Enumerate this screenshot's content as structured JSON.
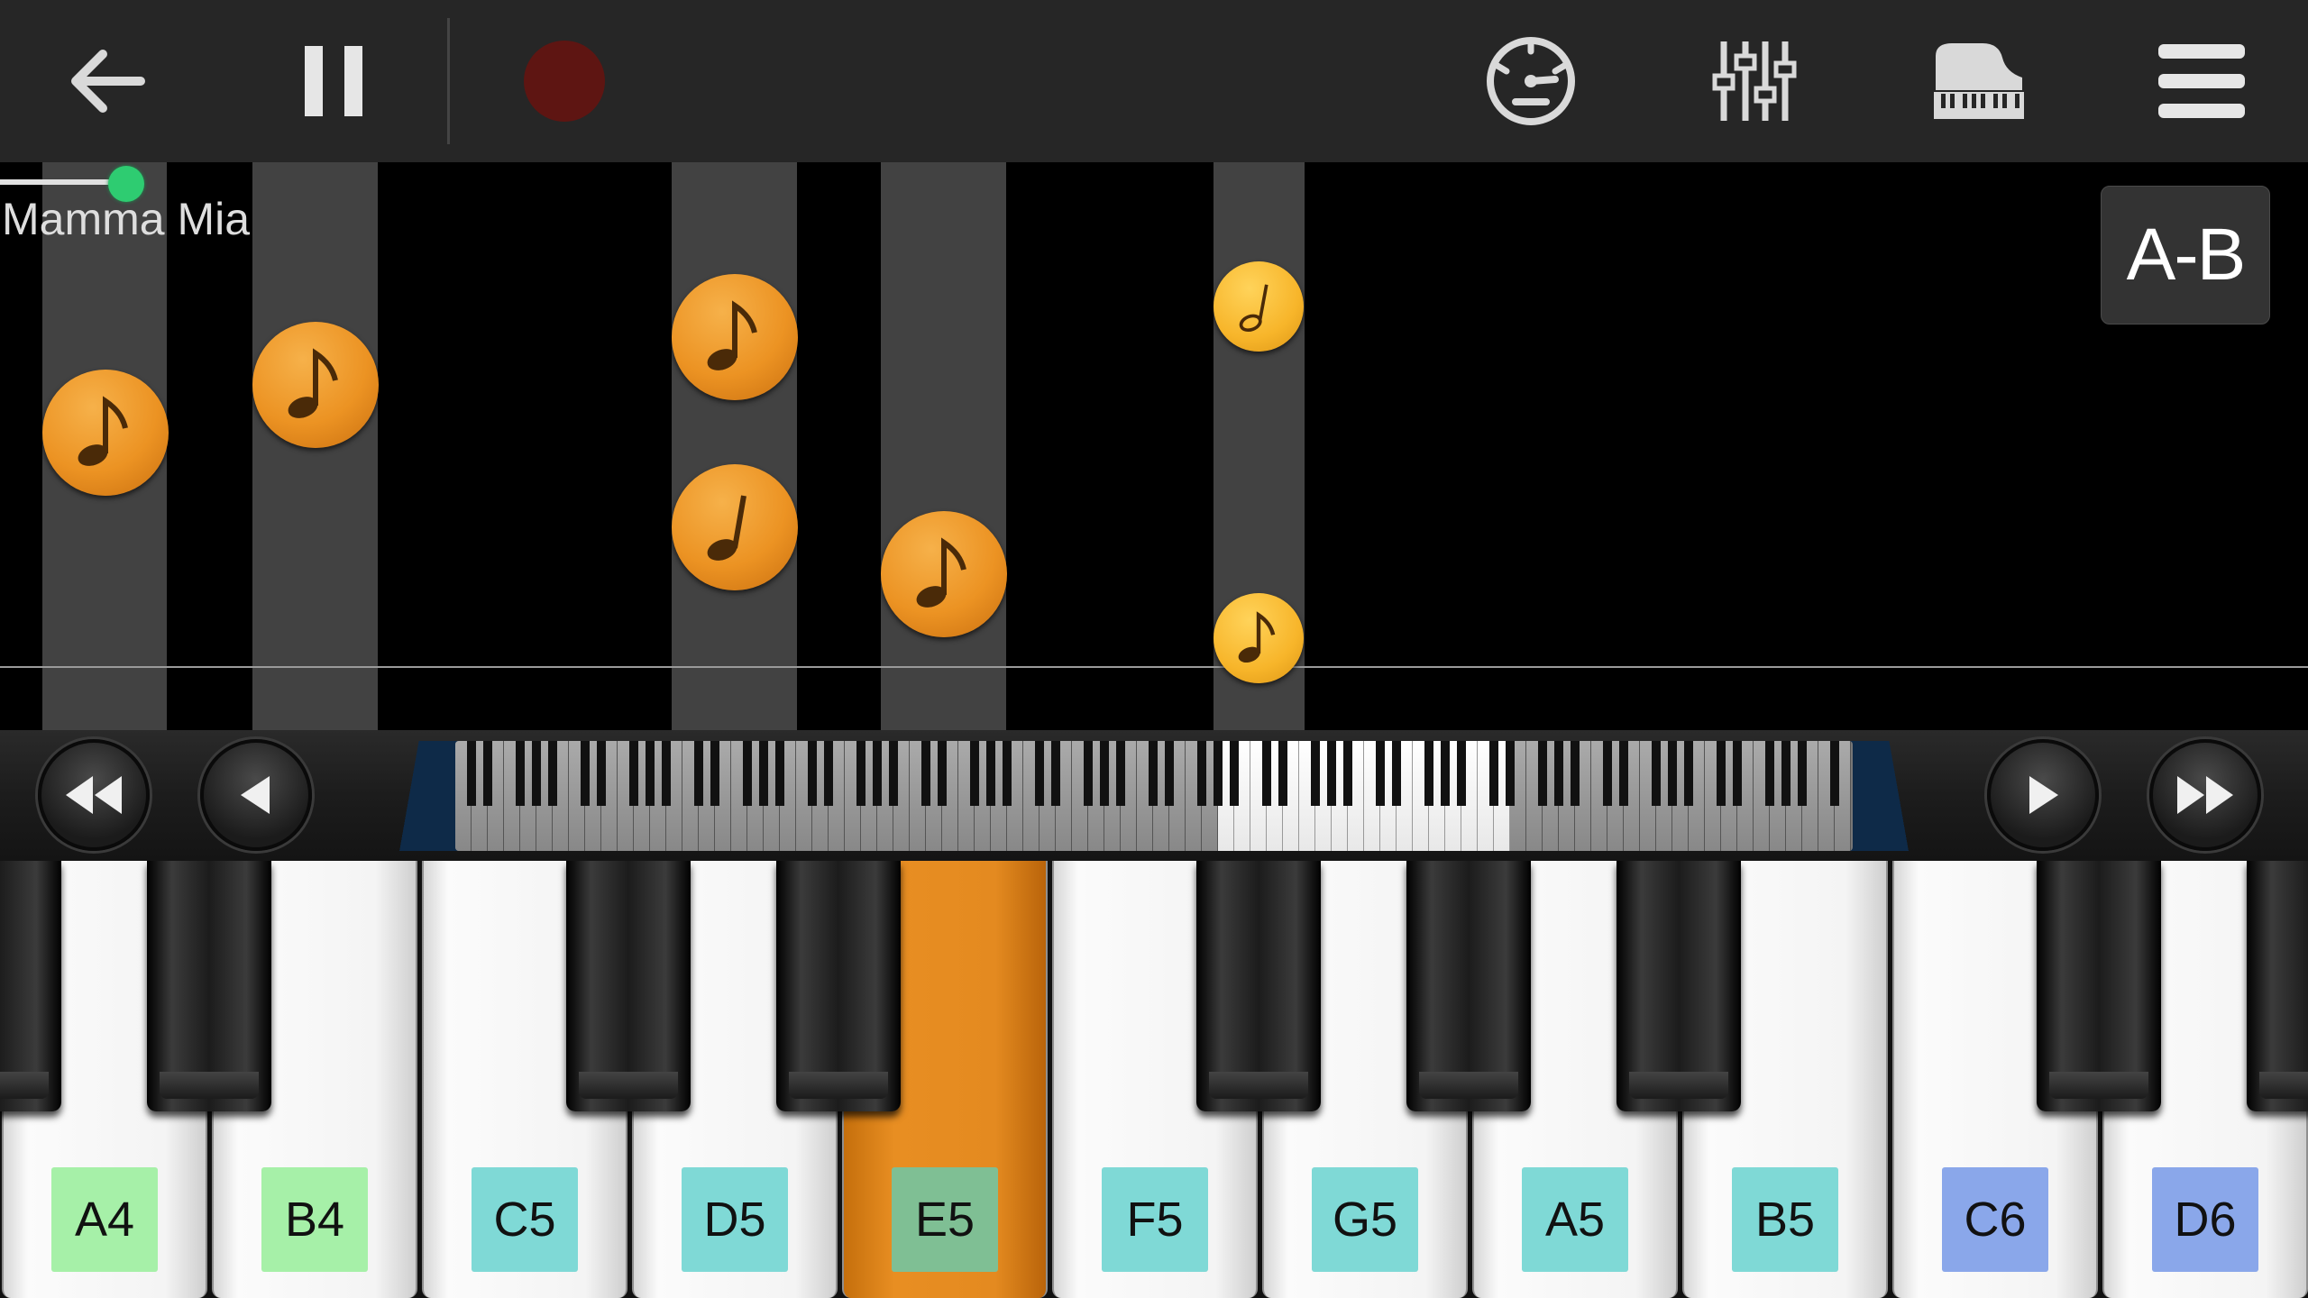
{
  "toolbar": {
    "back_icon": "arrow-left-icon",
    "pause_icon": "pause-icon",
    "record_icon": "record-dot-icon",
    "record_color": "#5e1512",
    "metronome_icon": "metronome-icon",
    "mixer_icon": "mixer-sliders-icon",
    "instrument_icon": "grand-piano-icon",
    "menu_icon": "hamburger-menu-icon"
  },
  "song": {
    "title": "Mamma Mia",
    "progress_fraction": 0.04
  },
  "ab_loop": {
    "label": "A-B"
  },
  "navigator": {
    "rewind_fast_icon": "fast-rewind-icon",
    "step_back_icon": "step-left-icon",
    "step_forward_icon": "step-right-icon",
    "forward_fast_icon": "fast-forward-icon"
  },
  "keys": [
    {
      "label": "A4",
      "color": "#a6f0a8",
      "active": false
    },
    {
      "label": "B4",
      "color": "#a6f0a8",
      "active": false
    },
    {
      "label": "C5",
      "color": "#7fd9d6",
      "active": false
    },
    {
      "label": "D5",
      "color": "#7fd9d6",
      "active": false
    },
    {
      "label": "E5",
      "color": "#7fbf94",
      "active": true
    },
    {
      "label": "F5",
      "color": "#7fd9d6",
      "active": false
    },
    {
      "label": "G5",
      "color": "#7fd9d6",
      "active": false
    },
    {
      "label": "A5",
      "color": "#7fd9d6",
      "active": false
    },
    {
      "label": "B5",
      "color": "#7fd9d6",
      "active": false
    },
    {
      "label": "C6",
      "color": "#8aa7ea",
      "active": false
    },
    {
      "label": "D6",
      "color": "#8aa7ea",
      "active": false
    }
  ],
  "colors": {
    "active_key": "#e88e22",
    "note_big": "#ec9323",
    "note_small": "#f7b52a",
    "progress_knob": "#2ecc71"
  }
}
